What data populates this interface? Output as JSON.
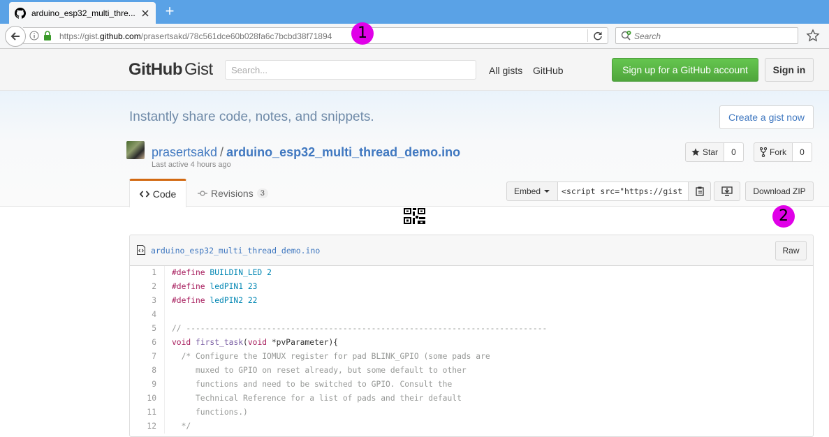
{
  "browser": {
    "tab_title": "arduino_esp32_multi_thre...",
    "new_tab": "+",
    "url_prefix": "https://gist.",
    "url_domain": "github.com",
    "url_path": "/prasertsakd/78c561dce60b028fa6c7bcbd38f71894",
    "search_placeholder": "Search",
    "annotation_1": "1",
    "annotation_2": "2"
  },
  "header": {
    "logo_bold": "GitHub",
    "logo_light": "Gist",
    "search_placeholder": "Search...",
    "nav": [
      "All gists",
      "GitHub"
    ],
    "signup_label": "Sign up for a GitHub account",
    "signin_label": "Sign in"
  },
  "hero": {
    "tagline": "Instantly share code, notes, and snippets.",
    "create_label": "Create a gist now"
  },
  "gist": {
    "owner": "prasertsakd",
    "slash": "/",
    "filename": "arduino_esp32_multi_thread_demo.ino",
    "last_active": "Last active 4 hours ago",
    "star_label": "Star",
    "star_count": "0",
    "fork_label": "Fork",
    "fork_count": "0",
    "tabs": {
      "code_label": "Code",
      "revisions_label": "Revisions",
      "revisions_count": "3"
    },
    "embed_label": "Embed",
    "embed_code": "<script src=\"https://gist",
    "download_zip_label": "Download ZIP"
  },
  "file": {
    "name": "arduino_esp32_multi_thread_demo.ino",
    "raw_label": "Raw",
    "lines": [
      {
        "n": "1",
        "t": [
          [
            "kw",
            "#define"
          ],
          [
            "",
            " "
          ],
          [
            "nm",
            "BUILDIN_LED"
          ],
          [
            "",
            " "
          ],
          [
            "nm",
            "2"
          ]
        ]
      },
      {
        "n": "2",
        "t": [
          [
            "kw",
            "#define"
          ],
          [
            "",
            " "
          ],
          [
            "nm",
            "ledPIN1"
          ],
          [
            "",
            " "
          ],
          [
            "nm",
            "23"
          ]
        ]
      },
      {
        "n": "3",
        "t": [
          [
            "kw",
            "#define"
          ],
          [
            "",
            " "
          ],
          [
            "nm",
            "ledPIN2"
          ],
          [
            "",
            " "
          ],
          [
            "nm",
            "22"
          ]
        ]
      },
      {
        "n": "4",
        "t": [
          [
            "",
            ""
          ]
        ]
      },
      {
        "n": "5",
        "t": [
          [
            "cm",
            "// ----------------------------------------------------------------------------"
          ]
        ]
      },
      {
        "n": "6",
        "t": [
          [
            "kw",
            "void"
          ],
          [
            "",
            " "
          ],
          [
            "ent",
            "first_task"
          ],
          [
            "",
            "("
          ],
          [
            "kw",
            "void"
          ],
          [
            "",
            " *pvParameter){"
          ]
        ]
      },
      {
        "n": "7",
        "t": [
          [
            "cm",
            "  /* Configure the IOMUX register for pad BLINK_GPIO (some pads are"
          ]
        ]
      },
      {
        "n": "8",
        "t": [
          [
            "cm",
            "     muxed to GPIO on reset already, but some default to other"
          ]
        ]
      },
      {
        "n": "9",
        "t": [
          [
            "cm",
            "     functions and need to be switched to GPIO. Consult the"
          ]
        ]
      },
      {
        "n": "10",
        "t": [
          [
            "cm",
            "     Technical Reference for a list of pads and their default"
          ]
        ]
      },
      {
        "n": "11",
        "t": [
          [
            "cm",
            "     functions.)"
          ]
        ]
      },
      {
        "n": "12",
        "t": [
          [
            "cm",
            "  */"
          ]
        ]
      }
    ]
  }
}
